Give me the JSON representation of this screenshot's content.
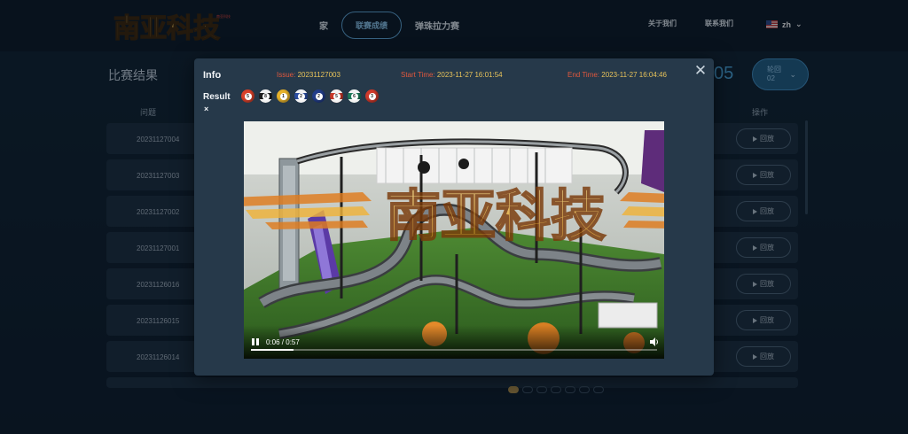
{
  "nav": {
    "home": "家",
    "league_results": "联赛成绩",
    "pinball": "弹珠拉力赛",
    "about": "关于我们",
    "contact": "联系我们",
    "lang": "zh"
  },
  "page": {
    "title": "比赛结果",
    "time_fragment": "05",
    "round_label": "轮回",
    "round_value": "02",
    "col_issue": "问题",
    "col_op": "操作",
    "replay_label": "回放",
    "rows": [
      "20231127004",
      "20231127003",
      "20231127002",
      "20231127001",
      "20231126016",
      "20231126015",
      "20231126014"
    ],
    "pagination": {
      "pages": 7,
      "current": 1
    }
  },
  "modal": {
    "info_label": "Info",
    "issue_label": "Issue:",
    "issue_value": "20231127003",
    "start_label": "Start Time:",
    "start_value": "2023-11-27 16:01:54",
    "end_label": "End Time:",
    "end_value": "2023-11-27 16:04:46",
    "result_label": "Result",
    "result_mark": "×",
    "close_icon": "close-icon",
    "balls": [
      {
        "number": "5",
        "color": "#d9412b",
        "striped": false
      },
      {
        "number": "8",
        "color": "#1d1d1d",
        "striped": true
      },
      {
        "number": "1",
        "color": "#e7b32c",
        "striped": false
      },
      {
        "number": "2",
        "color": "#2c4fa3",
        "striped": true
      },
      {
        "number": "2",
        "color": "#233e8a",
        "striped": false
      },
      {
        "number": "5",
        "color": "#c8392a",
        "striped": true
      },
      {
        "number": "6",
        "color": "#1f7a5a",
        "striped": true
      },
      {
        "number": "3",
        "color": "#cf3a2c",
        "striped": false
      }
    ]
  },
  "video": {
    "time_display": "0:06 / 0:57",
    "progress": 0.105,
    "watermark_text": "南亚科技"
  },
  "brand": {
    "logo_text": "南亚科技",
    "logo_small": "南亚科技"
  },
  "colors": {
    "accent": "#4aa8e0",
    "label_red": "#e2583d",
    "value_gold": "#e8c35a"
  }
}
